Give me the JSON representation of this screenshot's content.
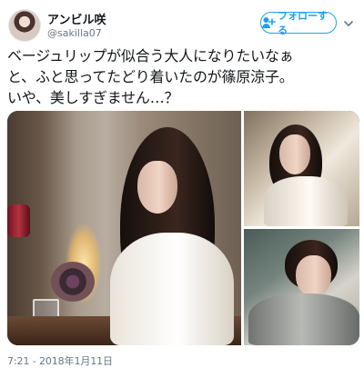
{
  "tweet": {
    "author": {
      "display_name": "アンビル咲",
      "handle": "@sakilla07"
    },
    "follow_button": {
      "label": "フォローする",
      "icon": "add-user-icon"
    },
    "menu_icon": "chevron-down-icon",
    "text_lines": [
      "ベージュリップが似合う大人になりたいなぁ",
      "と、ふと思ってたどり着いたのが篠原涼子。",
      "いや、美しすぎません…？"
    ],
    "photos": {
      "main": "woman-with-pen-photo",
      "top_right": "woman-at-window-photo",
      "bottom_right": "woman-resting-chin-photo"
    },
    "timestamp": "7:21 - 2018年1月11日",
    "colors": {
      "accent": "#1da1f2",
      "text": "#14171a",
      "secondary_text": "#657786"
    }
  }
}
